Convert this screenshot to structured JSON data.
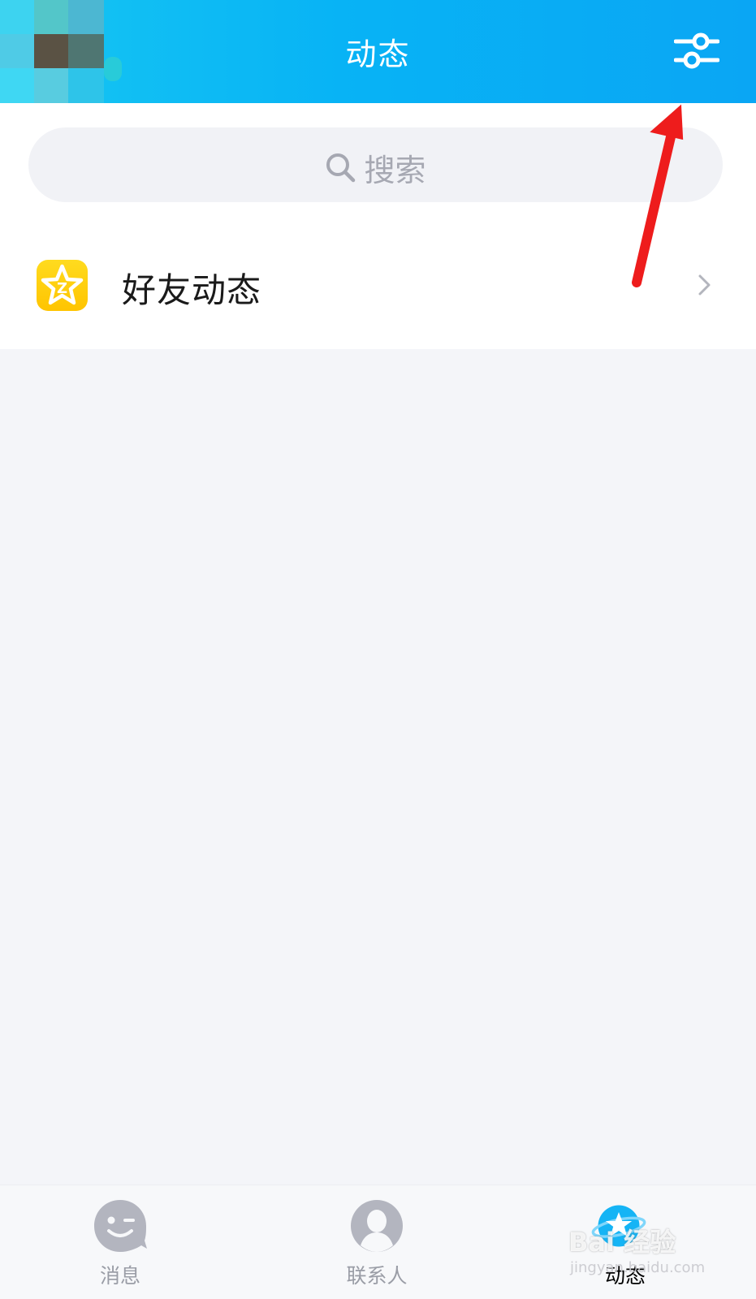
{
  "header": {
    "title": "动态",
    "filter_icon": "sliders-icon",
    "background": "#0aa6f4"
  },
  "search": {
    "placeholder": "搜索",
    "icon": "search-icon"
  },
  "list": {
    "items": [
      {
        "label": "好友动态",
        "icon": "qzone-star-icon",
        "icon_color": "#ffc400"
      }
    ]
  },
  "tabbar": {
    "tabs": [
      {
        "label": "消息",
        "icon": "message-face-icon",
        "active": false
      },
      {
        "label": "联系人",
        "icon": "contacts-person-icon",
        "active": false
      },
      {
        "label": "动态",
        "icon": "star-planet-icon",
        "active": true
      }
    ]
  },
  "watermark": {
    "main": "Bai 经验",
    "sub": "jingyan.baidu.com"
  },
  "colors": {
    "accent": "#0aa6f4",
    "page_bg": "#f4f5f9",
    "annotation_arrow": "#ee1c1c"
  }
}
